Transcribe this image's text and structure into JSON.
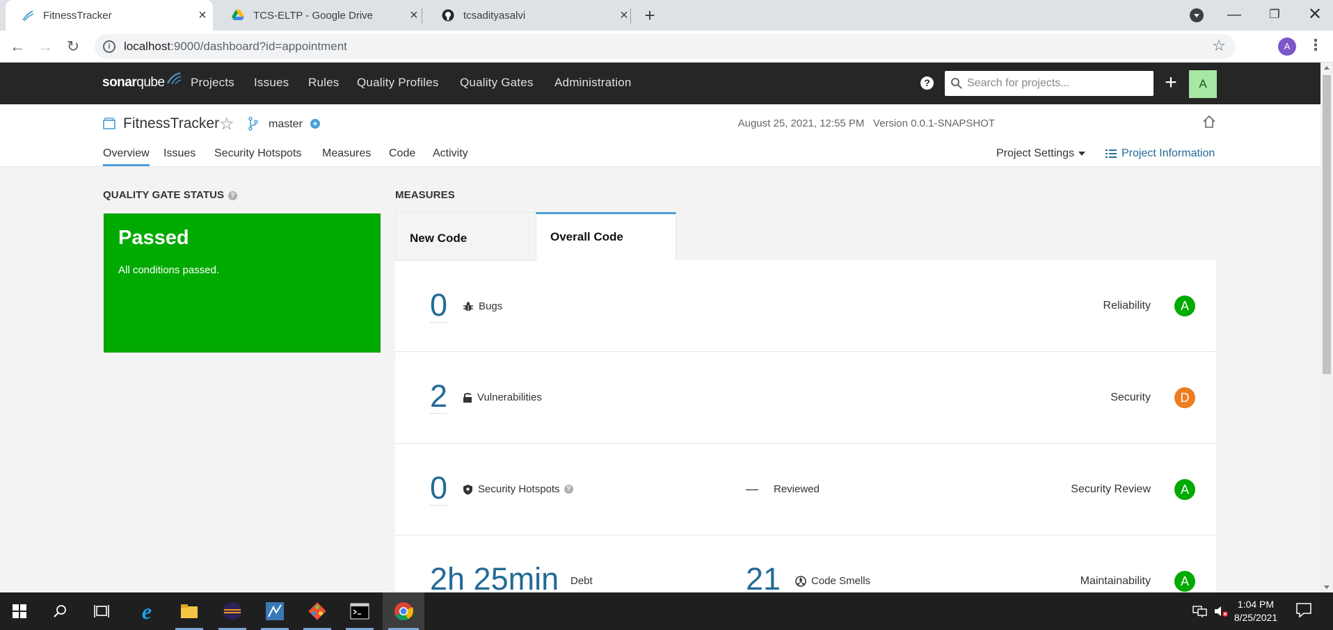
{
  "browser": {
    "tabs": [
      {
        "title": "FitnessTracker",
        "active": true
      },
      {
        "title": "TCS-ELTP - Google Drive",
        "active": false
      },
      {
        "title": "tcsadityasalvi",
        "active": false
      }
    ],
    "url_host": "localhost",
    "url_rest": ":9000/dashboard?id=appointment",
    "profile_initial": "A"
  },
  "sonar": {
    "logo_sonar": "sonar",
    "logo_qube": "qube",
    "menu": [
      "Projects",
      "Issues",
      "Rules",
      "Quality Profiles",
      "Quality Gates",
      "Administration"
    ],
    "search_placeholder": "Search for projects...",
    "user_initial": "A"
  },
  "project": {
    "name": "FitnessTracker",
    "branch": "master",
    "analysis_date": "August 25, 2021, 12:55 PM",
    "version": "Version 0.0.1-SNAPSHOT",
    "tabs": [
      "Overview",
      "Issues",
      "Security Hotspots",
      "Measures",
      "Code",
      "Activity"
    ],
    "settings_label": "Project Settings",
    "info_label": "Project Information"
  },
  "quality_gate": {
    "title": "QUALITY GATE STATUS",
    "status": "Passed",
    "message": "All conditions passed.",
    "color": "#00aa00"
  },
  "measures": {
    "title": "MEASURES",
    "tab_new": "New Code",
    "tab_overall": "Overall Code",
    "rows": [
      {
        "value": "0",
        "label": "Bugs",
        "rating_name": "Reliability",
        "rating": "A",
        "rating_color": "#00aa00"
      },
      {
        "value": "2",
        "label": "Vulnerabilities",
        "rating_name": "Security",
        "rating": "D",
        "rating_color": "#ed7d20"
      },
      {
        "value": "0",
        "label": "Security Hotspots",
        "middle_dash": "—",
        "middle_label": "Reviewed",
        "rating_name": "Security Review",
        "rating": "A",
        "rating_color": "#00aa00"
      },
      {
        "value": "2h 25min",
        "label": "Debt",
        "middle_value": "21",
        "middle_label": "Code Smells",
        "rating_name": "Maintainability",
        "rating": "A",
        "rating_color": "#00aa00"
      }
    ]
  },
  "taskbar": {
    "time": "1:04 PM",
    "date": "8/25/2021"
  }
}
